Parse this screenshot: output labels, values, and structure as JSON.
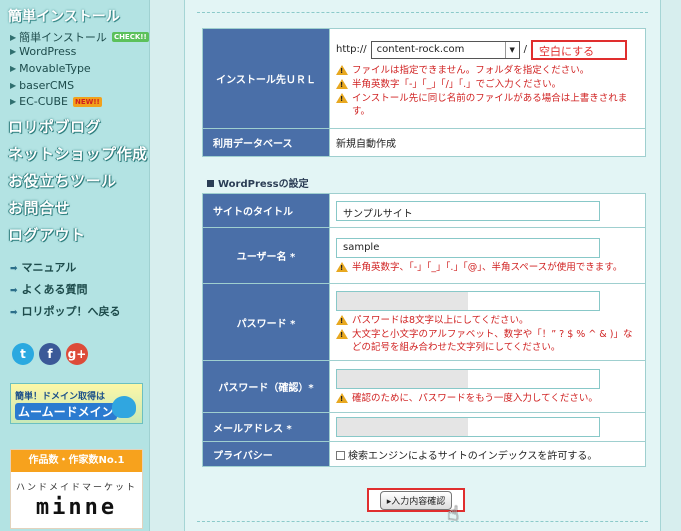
{
  "sidebar": {
    "easy_install_heading": "簡単インストール",
    "install_items": [
      {
        "label": "簡単インストール",
        "badge": "CHECK!!"
      },
      {
        "label": "WordPress",
        "badge": ""
      },
      {
        "label": "MovableType",
        "badge": ""
      },
      {
        "label": "baserCMS",
        "badge": ""
      },
      {
        "label": "EC-CUBE",
        "badge": "NEW!!"
      }
    ],
    "big_links": [
      "ロリポブログ",
      "ネットショップ作成",
      "お役立ちツール",
      "お問合せ",
      "ログアウト"
    ],
    "small_links": [
      "マニュアル",
      "よくある質問",
      "ロリポップ！へ戻る"
    ],
    "social_icons": [
      "twitter-icon",
      "facebook-icon",
      "google-plus-icon"
    ],
    "domain_banner": {
      "line1": "簡単！ドメイン取得は",
      "line2": "ムームードメイン"
    },
    "minne_banner": {
      "top": "作品数・作家数No.1",
      "middle": "ハンドメイドマーケット",
      "logo": "minne"
    }
  },
  "install_table": {
    "install_dest_label": "インストール先ＵＲＬ",
    "url_prefix": "http://",
    "domain_select": "content-rock.com",
    "slash": "/",
    "directory_value": "空白にする",
    "install_warnings": [
      "ファイルは指定できません。フォルダを指定ください。",
      "半角英数字「-」「_」「/」「.」でご入力ください。",
      "インストール先に同じ名前のファイルがある場合は上書きされます。"
    ],
    "db_label": "利用データベース",
    "db_value": "新規自動作成"
  },
  "wp_section_title": "WordPressの設定",
  "wp_table": {
    "site_title_label": "サイトのタイトル",
    "site_title_value": "サンプルサイト",
    "username_label": "ユーザー名 *",
    "username_value": "sample",
    "username_warning": "半角英数字、「-」「_」「.」「@」、半角スペースが使用できます。",
    "password_label": "パスワード *",
    "password_warnings": [
      "パスワードは8文字以上にしてください。",
      "大文字と小文字のアルファベット、数字や「！” ? $ % ^ & )」などの記号を組み合わせた文字列にしてください。"
    ],
    "password_confirm_label": "パスワード（確認）*",
    "password_confirm_warning": "確認のために、パスワードをもう一度入力してください。",
    "email_label": "メールアドレス *",
    "privacy_label": "プライバシー",
    "privacy_checkbox": "検索エンジンによるサイトのインデックスを許可する。"
  },
  "confirm_button": "入力内容確認",
  "colors": {
    "label_bg": "#4a6fa8",
    "warning": "#d02222",
    "highlight": "#e02e2e"
  }
}
